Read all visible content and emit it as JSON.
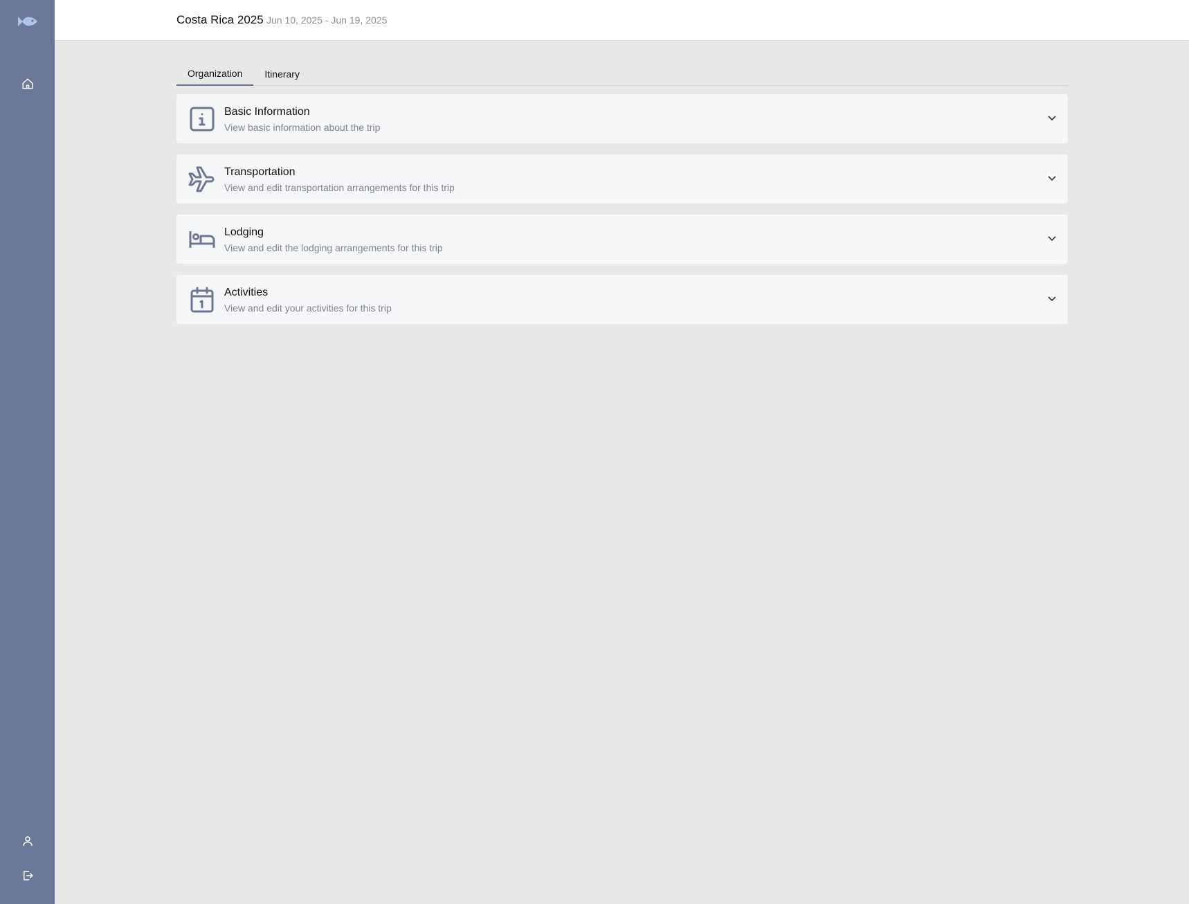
{
  "header": {
    "title": "Costa Rica 2025",
    "dates": "Jun 10, 2025 - Jun 19, 2025"
  },
  "sidebar": {
    "items": [
      {
        "icon": "fish-logo-icon"
      },
      {
        "icon": "home-icon"
      },
      {
        "icon": "user-icon"
      },
      {
        "icon": "logout-icon"
      }
    ]
  },
  "tabs": [
    {
      "label": "Organization",
      "active": true
    },
    {
      "label": "Itinerary",
      "active": false
    }
  ],
  "sections": [
    {
      "icon": "info-icon",
      "title": "Basic Information",
      "subtitle": "View basic information about the trip"
    },
    {
      "icon": "plane-icon",
      "title": "Transportation",
      "subtitle": "View and edit transportation arrangements for this trip"
    },
    {
      "icon": "bed-icon",
      "title": "Lodging",
      "subtitle": "View and edit the lodging arrangements for this trip"
    },
    {
      "icon": "calendar-icon",
      "title": "Activities",
      "subtitle": "View and edit your activities for this trip"
    }
  ],
  "colors": {
    "sidebar": "#6a7897",
    "accent": "#5f6d8f",
    "icon": "#6a7897",
    "logo": "#a9c6e8"
  }
}
